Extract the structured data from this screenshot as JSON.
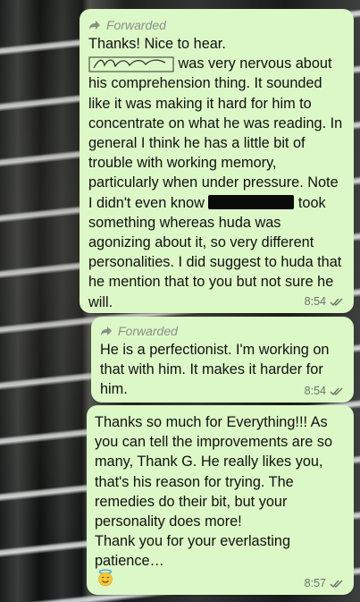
{
  "messages": [
    {
      "forwarded_label": "Forwarded",
      "text_part1": "Thanks! Nice to hear.\n",
      "text_part2": "was very nervous about his comprehension thing. It sounded like it was making it hard for him to concentrate on what he was reading. In general I think he has a little bit of trouble with working memory, particularly when under pressure. Note I didn't even know",
      "text_part3": "took something  whereas huda was agonizing about it, so very different personalities. I did suggest to huda that he mention that to you but not sure he will.",
      "time": "8:54"
    },
    {
      "forwarded_label": "Forwarded",
      "text": "He is a perfectionist. I'm working on that with him. It makes it harder for him.",
      "time": "8:54"
    },
    {
      "text": "Thanks so much for Everything!!! As you can tell the improvements are so many, Thank G. He really likes you, that's his reason for trying. The remedies do their bit, but your personality does more!\nThank you for your everlasting patience…",
      "emoji": "smiling-face-with-halo",
      "time": "8:57"
    }
  ],
  "colors": {
    "bubble": "#dcf8c6",
    "meta": "#6b706b",
    "forwarded": "#8a8f8a"
  }
}
